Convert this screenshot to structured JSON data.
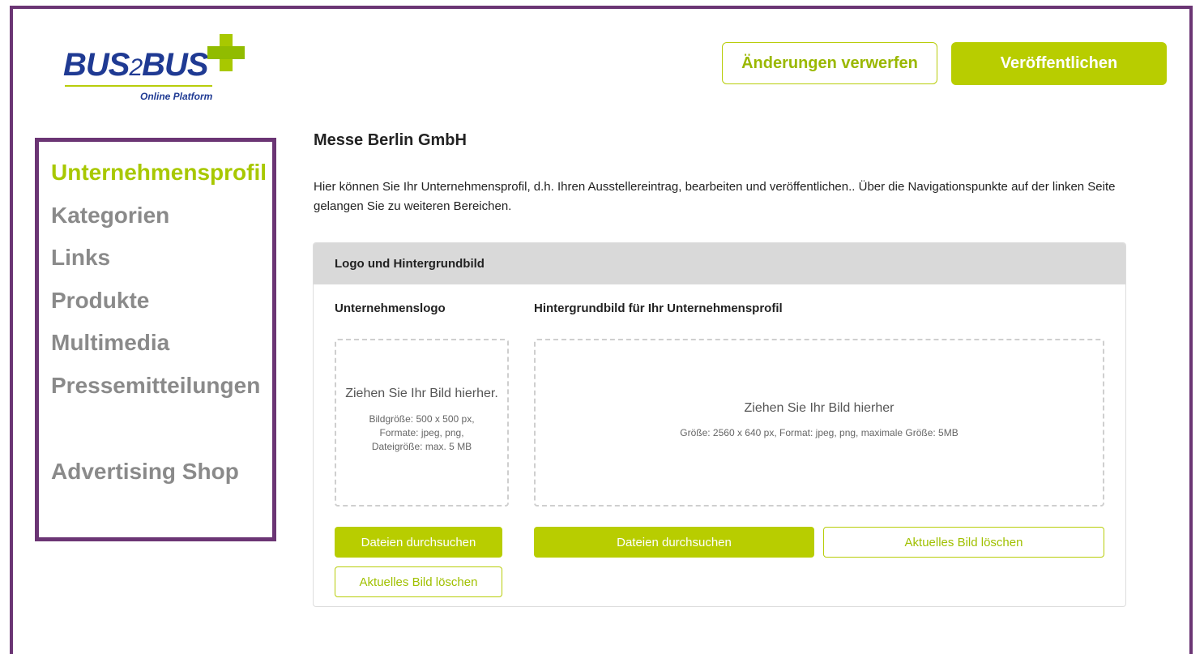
{
  "brand": {
    "logo_main": "BUS",
    "logo_two": "2",
    "logo_main2": "BUS",
    "logo_sub": "Online Platform"
  },
  "header": {
    "discard_label": "Änderungen verwerfen",
    "publish_label": "Veröffentlichen"
  },
  "sidebar": {
    "items": [
      {
        "label": "Unternehmensprofil",
        "active": true
      },
      {
        "label": "Kategorien"
      },
      {
        "label": "Links"
      },
      {
        "label": "Produkte"
      },
      {
        "label": "Multimedia"
      },
      {
        "label": "Pressemitteilungen"
      },
      {
        "label": "Advertising Shop"
      }
    ]
  },
  "main": {
    "company_name": "Messe Berlin GmbH",
    "intro": "Hier können Sie Ihr Unternehmensprofil, d.h. Ihren Ausstellereintrag, bearbeiten und veröffentlichen.. Über die Navigationspunkte auf der linken Seite gelangen Sie zu weiteren Bereichen.",
    "panel": {
      "title": "Logo und Hintergrundbild",
      "logo_label": "Unternehmenslogo",
      "bg_label": "Hintergrundbild für Ihr Unternehmensprofil",
      "logo_drop_title": "Ziehen Sie Ihr Bild hierher.",
      "logo_drop_info": "Bildgröße: 500 x 500 px, Formate: jpeg, png, Dateigröße: max. 5 MB",
      "bg_drop_title": "Ziehen Sie Ihr Bild hierher",
      "bg_drop_info": "Größe: 2560 x 640 px, Format: jpeg, png, maximale Größe: 5MB",
      "browse_label": "Dateien durchsuchen",
      "delete_label": "Aktuelles Bild löschen"
    }
  },
  "colors": {
    "accent": "#b8cd00",
    "frame": "#6b3574",
    "brand_blue": "#1f3a93"
  }
}
